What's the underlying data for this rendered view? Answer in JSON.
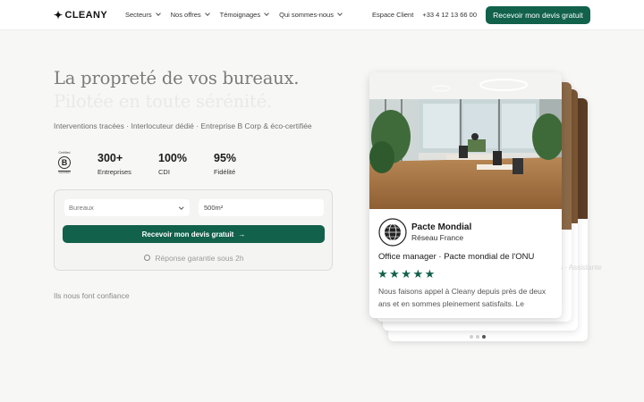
{
  "nav": {
    "logo": "CLEANY",
    "menu": [
      {
        "label": "Secteurs"
      },
      {
        "label": "Nos offres"
      },
      {
        "label": "Témoignages"
      },
      {
        "label": "Qui sommes-nous"
      }
    ],
    "client_link": "Espace Client",
    "phone": "+33 4 12 13 66 00",
    "cta": "Recevoir mon devis gratuit"
  },
  "hero": {
    "title_line1": "La propreté de vos bureaux.",
    "title_line2": "Pilotée en toute sérénité.",
    "subtitle": "Interventions tracées · Interlocuteur dédié · Entreprise B Corp & éco-certifiée",
    "certification": {
      "top": "Certified",
      "letter": "B",
      "bottom": "Corporation"
    },
    "stats": [
      {
        "value": "300+",
        "label": "Entreprises"
      },
      {
        "value": "100%",
        "label": "CDI"
      },
      {
        "value": "95%",
        "label": "Fidélité"
      }
    ]
  },
  "form": {
    "sector_selected": "Bureaux",
    "surface_value": "500m²",
    "submit_label": "Recevoir mon devis gratuit",
    "guarantee": "Réponse garantie sous 2h"
  },
  "trust_heading": "Ils nous font confiance",
  "testimonial": {
    "org_name": "Pacte Mondial",
    "org_sub": "Réseau France",
    "role": "Office manager · Pacte mondial de l'ONU",
    "rating": 5,
    "stars": "★★★★★",
    "quote": "Nous faisons appel à Cleany depuis près de deux ans et en sommes pleinement satisfaits. Le binôme...",
    "ghost_role": "· Bon Kréations · Assistante",
    "dots_active_index": 2,
    "dots_count": 3
  },
  "colors": {
    "brand_green": "#11614b",
    "title_gray": "#7b7b7b"
  }
}
